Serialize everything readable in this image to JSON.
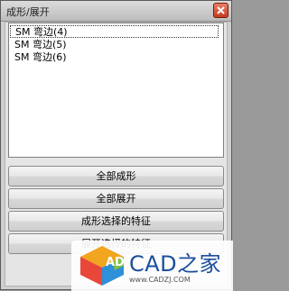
{
  "window": {
    "title": "成形/展开"
  },
  "list": {
    "items": [
      "SM 弯边(4)",
      "SM 弯边(5)",
      "SM 弯边(6)"
    ]
  },
  "buttons": {
    "form_all": "全部成形",
    "unform_all": "全部展开",
    "form_selected": "成形选择的特征",
    "unform_selected": "展开选择的特征"
  },
  "watermark": {
    "brand": "CAD之家",
    "url": "www.CADZJ.COM",
    "logo_letters": "AD"
  },
  "colors": {
    "close_button": "#c43d1f",
    "brand_blue": "#1b4f9c"
  }
}
